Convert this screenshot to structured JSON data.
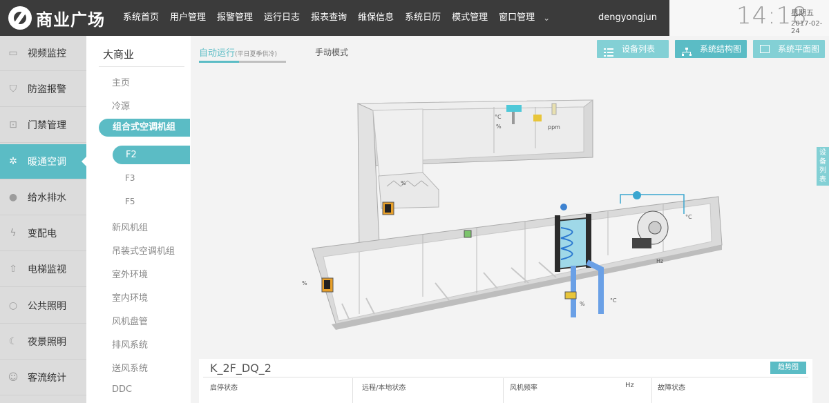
{
  "header": {
    "logo_text": "商业广场",
    "nav": [
      "系统首页",
      "用户管理",
      "报警管理",
      "运行日志",
      "报表查询",
      "维保信息",
      "系统日历",
      "模式管理",
      "窗口管理"
    ],
    "caret": "⌄",
    "username": "dengyongjun",
    "time": "14:18",
    "weekday": "星期五",
    "date": "2017-02-24"
  },
  "sidebar": {
    "items": [
      {
        "label": "视频监控",
        "icon": "camera-icon",
        "glyph": "▭"
      },
      {
        "label": "防盗报警",
        "icon": "shield-icon",
        "glyph": "⛉"
      },
      {
        "label": "门禁管理",
        "icon": "lock-icon",
        "glyph": "⊡"
      },
      {
        "label": "暖通空调",
        "icon": "fan-icon",
        "glyph": "✲"
      },
      {
        "label": "给水排水",
        "icon": "water-drop-icon",
        "glyph": "●"
      },
      {
        "label": "变配电",
        "icon": "lightning-icon",
        "glyph": "ϟ"
      },
      {
        "label": "电梯监视",
        "icon": "elevator-icon",
        "glyph": "⇧"
      },
      {
        "label": "公共照明",
        "icon": "bulb-icon",
        "glyph": "○"
      },
      {
        "label": "夜景照明",
        "icon": "moon-icon",
        "glyph": "☾"
      },
      {
        "label": "客流统计",
        "icon": "people-icon",
        "glyph": "☺"
      }
    ],
    "active_index": 3
  },
  "subnav": {
    "title": "大商业",
    "items": [
      "主页",
      "冷源"
    ],
    "active_group": "组合式空调机组",
    "active_child": "F2",
    "children": [
      "F3",
      "F5"
    ],
    "more": [
      "新风机组",
      "吊装式空调机组",
      "室外环境",
      "室内环境",
      "风机盘管",
      "排风系统",
      "送风系统",
      "DDC"
    ]
  },
  "main": {
    "tab_auto": "自动运行",
    "tab_auto_note": "(平日夏季供冷)",
    "tab_manual": "手动模式",
    "buttons": [
      "设备列表",
      "系统结构图",
      "系统平面图"
    ],
    "side_tab": [
      "设",
      "备",
      "列",
      "表"
    ]
  },
  "diagram_labels": {
    "top_celsius": "°C",
    "top_percent": "%",
    "top_ppm": "ppm",
    "damper_percent": "%",
    "left_percent": "%",
    "valve_percent": "%",
    "water_celsius": "°C",
    "supply_celsius": "°C",
    "fan_hz": "Hz"
  },
  "info": {
    "unit": "K_2F_DQ_2",
    "trend": "趋势图",
    "row1": [
      "启停状态",
      "远程/本地状态",
      "风机频率",
      "Hz",
      "故障状态"
    ]
  },
  "colors": {
    "accent": "#5bbcc5",
    "accent_light": "#83d0d5",
    "topbar": "#3b3b3b"
  }
}
